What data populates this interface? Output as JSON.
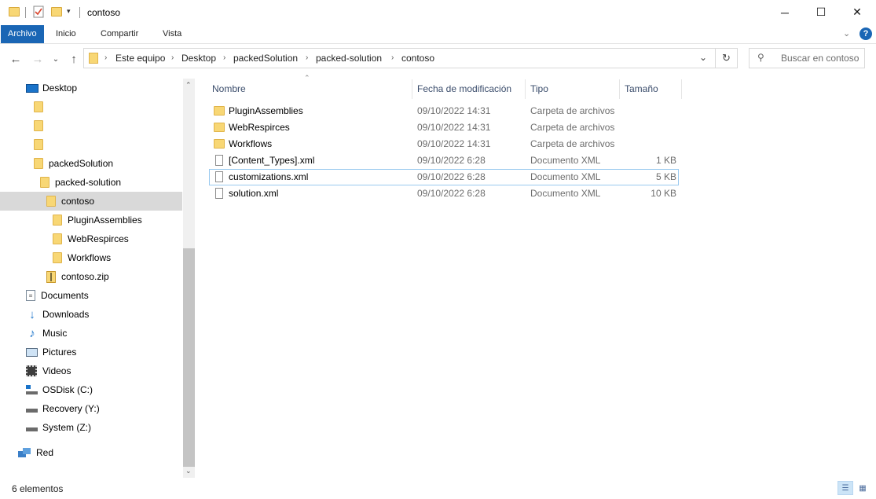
{
  "window": {
    "title": "contoso"
  },
  "ribbon": {
    "tabs": [
      "Archivo",
      "Inicio",
      "Compartir",
      "Vista"
    ]
  },
  "address": {
    "breadcrumb": [
      "Este equipo",
      "Desktop",
      "packedSolution",
      "packed-solution",
      "contoso"
    ]
  },
  "search": {
    "placeholder": "Buscar en contoso"
  },
  "nav_tree": {
    "desktop": "Desktop",
    "packedSolution": "packedSolution",
    "packed_solution": "packed-solution",
    "contoso": "contoso",
    "pluginAssemblies": "PluginAssemblies",
    "webRespirces": "WebRespirces",
    "workflows": "Workflows",
    "contoso_zip": "contoso.zip",
    "documents": "Documents",
    "downloads": "Downloads",
    "music": "Music",
    "pictures": "Pictures",
    "videos": "Videos",
    "osdisk": "OSDisk (C:)",
    "recovery": "Recovery (Y:)",
    "system": "System (Z:)",
    "red": "Red"
  },
  "columns": {
    "name": "Nombre",
    "date": "Fecha de modificación",
    "type": "Tipo",
    "size": "Tamaño"
  },
  "files": [
    {
      "name": "PluginAssemblies",
      "date": "09/10/2022 14:31",
      "type": "Carpeta de archivos",
      "size": ""
    },
    {
      "name": "WebRespirces",
      "date": "09/10/2022 14:31",
      "type": "Carpeta de archivos",
      "size": ""
    },
    {
      "name": "Workflows",
      "date": "09/10/2022 14:31",
      "type": "Carpeta de archivos",
      "size": ""
    },
    {
      "name": "[Content_Types].xml",
      "date": "09/10/2022 6:28",
      "type": "Documento XML",
      "size": "1 KB"
    },
    {
      "name": "customizations.xml",
      "date": "09/10/2022 6:28",
      "type": "Documento XML",
      "size": "5 KB"
    },
    {
      "name": "solution.xml",
      "date": "09/10/2022 6:28",
      "type": "Documento XML",
      "size": "10 KB"
    }
  ],
  "status": {
    "count": "6 elementos"
  },
  "colors": {
    "accent": "#1a66b5",
    "folder": "#f8d775",
    "selection": "#d9d9d9"
  }
}
